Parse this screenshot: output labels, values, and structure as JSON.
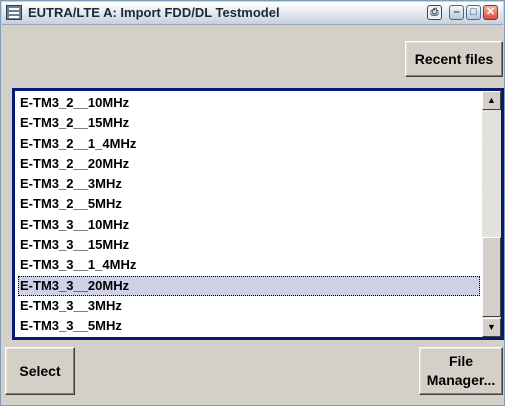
{
  "window": {
    "title": "EUTRA/LTE A: Import FDD/DL Testmodel"
  },
  "toolbar": {
    "recent_files_label": "Recent files"
  },
  "list": {
    "items": [
      "E-TM3_2__10MHz",
      "E-TM3_2__15MHz",
      "E-TM3_2__1_4MHz",
      "E-TM3_2__20MHz",
      "E-TM3_2__3MHz",
      "E-TM3_2__5MHz",
      "E-TM3_3__10MHz",
      "E-TM3_3__15MHz",
      "E-TM3_3__1_4MHz",
      "E-TM3_3__20MHz",
      "E-TM3_3__3MHz",
      "E-TM3_3__5MHz"
    ],
    "selected_index": 9
  },
  "footer": {
    "select_label": "Select",
    "file_manager_line1": "File",
    "file_manager_line2": "Manager..."
  }
}
